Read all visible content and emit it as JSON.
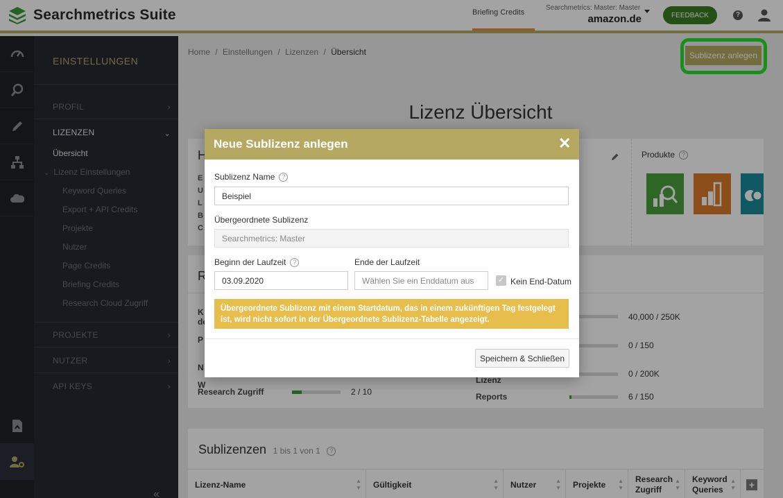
{
  "header": {
    "app_name": "Searchmetrics Suite",
    "briefing_credits_tab": "Briefing Credits",
    "account_label": "Searchmetrics: Master: Master",
    "account_domain": "amazon.de",
    "feedback_label": "FEEDBACK",
    "help_symbol": "?"
  },
  "rail": {
    "icons": [
      "dashboard-icon",
      "search-research-icon",
      "pencil-icon",
      "sitemap-icon",
      "cloud-icon",
      "document-icon",
      "user-settings-icon"
    ]
  },
  "sidebar": {
    "title": "EINSTELLUNGEN",
    "profil": "PROFIL",
    "lizenzen": "LIZENZEN",
    "uebersicht": "Übersicht",
    "lizenz_einstellungen": "Lizenz Einstellungen",
    "sub_items": [
      "Keyword Queries",
      "Export + API Credits",
      "Projekte",
      "Nutzer",
      "Page Credits",
      "Briefing Credits",
      "Research Cloud Zugriff"
    ],
    "projekte": "PROJEKTE",
    "nutzer": "NUTZER",
    "api_keys": "API KEYS",
    "collapse_symbol": "«"
  },
  "main": {
    "breadcrumb": {
      "home": "Home",
      "einstellungen": "Einstellungen",
      "lizenzen": "Lizenzen",
      "current": "Übersicht",
      "separator": "/"
    },
    "new_sublicense_button": "Sublizenz anlegen",
    "page_title": "Lizenz Übersicht",
    "card1_heading": "H",
    "card1_row_letters": [
      "E",
      "U",
      "L",
      "B",
      "C"
    ],
    "products_title": "Produkte",
    "card2_heading": "R",
    "left_metrics": [
      {
        "label": "K",
        "label2": "de"
      },
      {
        "label": "P"
      },
      {
        "label": "N"
      },
      {
        "label": "W"
      },
      {
        "label": "Research Zugriff",
        "value": "2 / 10",
        "fill": 0.2
      }
    ],
    "right_metrics": [
      {
        "label": "",
        "value": "40,000 / 250K",
        "fill": 0
      },
      {
        "label": "",
        "value": "0 / 150",
        "fill": 0
      },
      {
        "label": "Lizenz",
        "value": "0 / 200K",
        "fill": 0
      },
      {
        "label": "Reports",
        "value": "6 / 150",
        "fill": 0.04
      }
    ],
    "sublicenses": {
      "title": "Sublizenzen",
      "count": "1 bis 1 von 1",
      "columns": [
        "Lizenz-Name",
        "Gültigkeit",
        "Nutzer",
        "Projekte",
        "Research Zugriff",
        "Keyword Queries"
      ],
      "add_symbol": "+"
    }
  },
  "modal": {
    "title": "Neue Sublizenz anlegen",
    "close_symbol": "✕",
    "name_label": "Sublizenz Name",
    "name_value": "Beispiel",
    "parent_label": "Übergeordnete Sublizenz",
    "parent_value": "Searchmetrics: Master",
    "start_label": "Beginn der Laufzeit",
    "start_value": "03.09.2020",
    "end_label": "Ende der Laufzeit",
    "end_placeholder": "Wählen Sie ein Enddatum aus",
    "no_end_label": "Kein End-Datum",
    "no_end_checked": true,
    "warning": "Übergeordnete Sublizenz mit einem Startdatum, das in einem zukünftigen Tag festgelegt ist, wird nicht sofort in der Übergeordnete Sublizenz-Tabelle angezeigt.",
    "save_label": "Speichern & Schließen"
  },
  "colors": {
    "accent_gold": "#b5a962",
    "feedback_green": "#3a7d22",
    "warning_yellow": "#e7bd4b",
    "highlight_green": "#27e027",
    "tile_green": "#4aa03e",
    "tile_orange": "#d97b2b",
    "tile_teal": "#1a8a9a"
  }
}
